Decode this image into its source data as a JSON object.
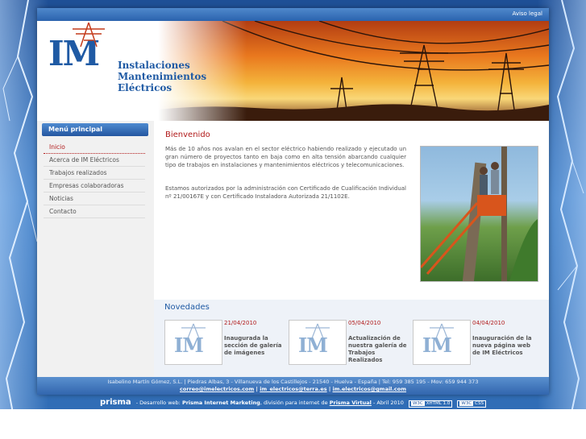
{
  "topbar": {
    "legal_link": "Aviso legal"
  },
  "brand": {
    "logo_mark": "IM",
    "name_lines": [
      "Instalaciones",
      "Mantenimientos",
      "Eléctricos"
    ]
  },
  "nav": {
    "heading": "Menú principal",
    "items": [
      {
        "label": "Inicio",
        "active": true
      },
      {
        "label": "Acerca de IM Eléctricos"
      },
      {
        "label": "Trabajos realizados"
      },
      {
        "label": "Empresas colaboradoras"
      },
      {
        "label": "Noticias"
      },
      {
        "label": "Contacto"
      }
    ]
  },
  "main": {
    "title": "Bienvenido",
    "paragraphs": [
      "Más de 10 años nos avalan en el sector eléctrico habiendo realizado y ejecutado un gran número de proyectos tanto en baja como en alta tensión abarcando cualquier tipo de trabajos en instalaciones y mantenimientos eléctricos y telecomunicaciones.",
      "Estamos autorizados por la administración con Certificado de Cualificación Individual nº 21/00167E y con Certificado Instaladora Autorizada 21/1102E."
    ]
  },
  "news": {
    "title": "Novedades",
    "items": [
      {
        "date": "21/04/2010",
        "text": "Inaugurada la sección de galería de imágenes"
      },
      {
        "date": "05/04/2010",
        "text": "Actualización de nuestra galería de Trabajos Realizados"
      },
      {
        "date": "04/04/2010",
        "text": "Inauguración de la nueva página web de IM Eléctricos"
      }
    ]
  },
  "footer": {
    "address": "Isabelino Martín Gómez, S.L. | Piedras Albas, 3 - Villanueva de los Castillejos - 21540 - Huelva - España | Tel: 959 385 195 - Mov: 659 944 373",
    "emails": [
      "correo@imelectricos.com",
      "im_electricos@terra.es",
      "im.electricos@gmail.com"
    ]
  },
  "credits": {
    "brand": "prisma",
    "prefix": "- Desarrollo web:",
    "developer": "Prisma Internet Marketing",
    "middle": ", división para internet de",
    "parent": "Prisma Virtual",
    "suffix": "- Abril 2010",
    "badge_xhtml": [
      "W3C",
      "XHTML 1.0"
    ],
    "badge_css": [
      "W3C",
      "CSS"
    ]
  },
  "colors": {
    "accent_blue": "#1f5aa4",
    "accent_red": "#b11b1b"
  }
}
